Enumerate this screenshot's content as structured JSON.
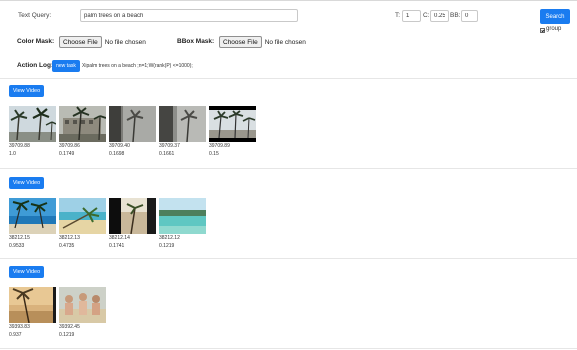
{
  "query": {
    "label": "Text Query:",
    "value": "palm trees on a beach"
  },
  "params": [
    {
      "label": "T:",
      "value": "1"
    },
    {
      "label": "C:",
      "value": "0.25"
    },
    {
      "label": "BB:",
      "value": "0"
    }
  ],
  "search_button": "Search",
  "group_label": "group",
  "group_checked": true,
  "color_mask": {
    "label": "Color Mask:",
    "button": "Choose File",
    "status": "No file chosen"
  },
  "bbox_mask": {
    "label": "BBox Mask:",
    "button": "Choose File",
    "status": "No file chosen"
  },
  "action_log": {
    "label": "Action Log:",
    "button": "new task",
    "text": "Xipalm trees on a beach ;n=1;W(rank(P) <=1000);"
  },
  "view_video_label": "View Video",
  "groups": [
    {
      "frames": [
        {
          "id": "39709.88",
          "score": "1.0",
          "scene": "palm-bright"
        },
        {
          "id": "39709.86",
          "score": "0.1749",
          "scene": "palm-building"
        },
        {
          "id": "39709.40",
          "score": "0.1698",
          "scene": "palm-gray"
        },
        {
          "id": "39709.37",
          "score": "0.1661",
          "scene": "palm-gray2"
        },
        {
          "id": "39709.89",
          "score": "0.15",
          "scene": "palm-letterbox"
        }
      ]
    },
    {
      "frames": [
        {
          "id": "38212.15",
          "score": "0.9533",
          "scene": "beach-blue"
        },
        {
          "id": "38212.13",
          "score": "0.4735",
          "scene": "beach-sand"
        },
        {
          "id": "38212.14",
          "score": "0.1741",
          "scene": "beach-dark"
        },
        {
          "id": "38212.12",
          "score": "0.1219",
          "scene": "beach-lagoon"
        }
      ]
    },
    {
      "frames": [
        {
          "id": "39393.83",
          "score": "0.937",
          "scene": "sunset-palm"
        },
        {
          "id": "39392.45",
          "score": "0.1219",
          "scene": "people-beach"
        }
      ]
    }
  ]
}
